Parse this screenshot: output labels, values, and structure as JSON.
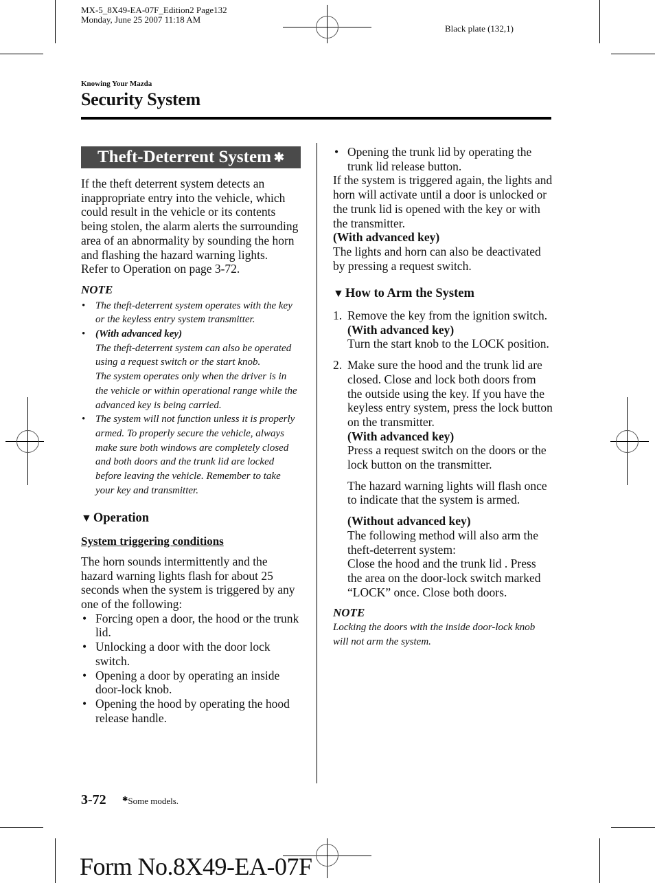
{
  "print_meta": {
    "file_line": "MX-5_8X49-EA-07F_Edition2 Page132",
    "date_line": "Monday, June 25 2007 11:18 AM",
    "plate": "Black plate (132,1)"
  },
  "header": {
    "kicker": "Knowing Your Mazda",
    "title": "Security System"
  },
  "left_column": {
    "banner_title": "Theft-Deterrent System",
    "banner_marker": "✱",
    "intro": "If the theft deterrent system detects an inappropriate entry into the vehicle, which could result in the vehicle or its contents being stolen, the alarm alerts the surrounding area of an abnormality by sounding the horn and flashing the hazard warning lights.",
    "refer": "Refer to Operation on page 3-72.",
    "note_label": "NOTE",
    "notes": [
      {
        "text": "The theft-deterrent system operates with the key or the keyless entry system transmitter."
      },
      {
        "bold_lead": "(With advanced key)",
        "text": "The theft-deterrent system can also be operated using a request switch or the start knob.",
        "text2": "The system operates only when the driver is in the vehicle or within operational range while the advanced key is being carried."
      },
      {
        "text": "The system will not function unless it is properly armed. To properly secure the vehicle, always make sure both windows are completely closed and both doors and the trunk lid are locked before leaving the vehicle. Remember to take your key and transmitter."
      }
    ],
    "operation_heading": "Operation",
    "triggering_heading": "System triggering conditions",
    "triggering_intro": "The horn sounds intermittently and the hazard warning lights flash for about 25 seconds when the system is triggered by any one of the following:",
    "triggers": [
      "Forcing open a door, the hood or the trunk lid.",
      "Unlocking a door with the door lock switch.",
      "Opening a door by operating an inside door-lock knob.",
      "Opening the hood by operating the hood release handle."
    ]
  },
  "right_column": {
    "trigger_continued": "Opening the trunk lid by operating the trunk lid release button.",
    "retrigger": "If the system is triggered again, the lights and horn will activate until a door is unlocked or the trunk lid is opened with the key or with the transmitter.",
    "adv_key_label": "(With advanced key)",
    "adv_key_text": "The lights and horn can also be deactivated by pressing a request switch.",
    "arm_heading": "How to Arm the System",
    "steps": [
      {
        "num": "1.",
        "text": "Remove the key from the ignition switch.",
        "bold": "(With advanced key)",
        "text2": "Turn the start knob to the LOCK position."
      },
      {
        "num": "2.",
        "text": "Make sure the hood and the trunk lid are closed. Close and lock both doors from the outside using the key. If you have the keyless entry system, press the lock button on the transmitter.",
        "bold": "(With advanced key)",
        "text2": "Press a request switch on the doors or the lock button on the transmitter.",
        "para2": "The hazard warning lights will flash once to indicate that the system is armed.",
        "bold3": "(Without advanced key)",
        "para3a": "The following method will also arm the theft-deterrent system:",
        "para3b": "Close the hood and the trunk lid . Press the area on the door-lock switch marked “LOCK” once. Close both doors."
      }
    ],
    "note_label": "NOTE",
    "note_text": "Locking the doors with the inside door-lock knob will not arm the system."
  },
  "footer": {
    "page_number": "3-72",
    "marker": "✱",
    "footnote": "Some models.",
    "form_number": "Form No.8X49-EA-07F"
  },
  "icons": {
    "triangle": "▼"
  }
}
